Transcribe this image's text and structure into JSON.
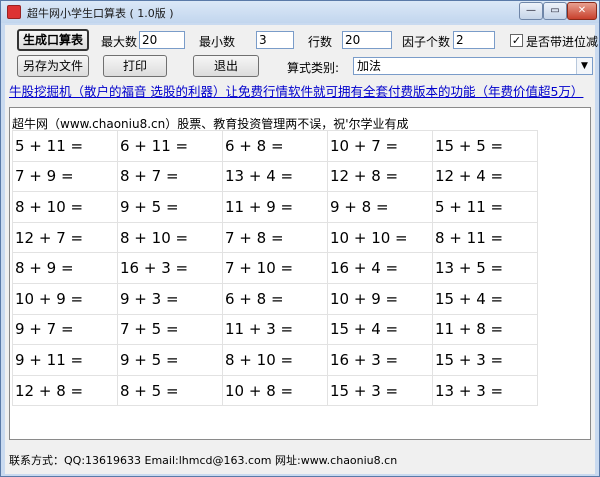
{
  "window": {
    "title": "超牛网小学生口算表 ( 1.0版 )",
    "controls": {
      "min": "—",
      "max": "▭",
      "close": "✕"
    }
  },
  "toolbar": {
    "generate_label": "生成口算表",
    "max_label": "最大数",
    "max_value": "20",
    "min_label": "最小数",
    "min_value": "3",
    "rows_label": "行数",
    "rows_value": "20",
    "factors_label": "因子个数",
    "factors_value": "2",
    "carry_label": "是否带进位减",
    "carry_checked": true,
    "save_as_label": "另存为文件",
    "print_label": "打印",
    "exit_label": "退出",
    "formula_type_label": "算式类别:",
    "formula_type_value": "加法"
  },
  "promo_link": "牛股挖掘机（散户的福音 选股的利器）让免费行情软件就可拥有全套付费版本的功能（年费价值超5万）",
  "sheet": {
    "header": "超牛网（www.chaoniu8.cn）股票、教育投资管理两不误，祝'尔学业有成",
    "rows": [
      [
        "5 + 11 =",
        "6 + 11 =",
        "6 + 8 =",
        "10 + 7 =",
        "15 + 5 ="
      ],
      [
        "7 + 9 =",
        "8 + 7 =",
        "13 + 4 =",
        "12 + 8 =",
        "12 + 4 ="
      ],
      [
        "8 + 10 =",
        "9 + 5 =",
        "11 + 9 =",
        "9 + 8 =",
        "5 + 11 ="
      ],
      [
        "12 + 7 =",
        "8 + 10 =",
        "7 + 8 =",
        "10 + 10 =",
        "8 + 11 ="
      ],
      [
        "8 + 9 =",
        "16 + 3 =",
        "7 + 10 =",
        "16 + 4 =",
        "13 + 5 ="
      ],
      [
        "10 + 9 =",
        "9 + 3 =",
        "6 + 8 =",
        "10 + 9 =",
        "15 + 4 ="
      ],
      [
        "9 + 7 =",
        "7 + 5 =",
        "11 + 3 =",
        "15 + 4 =",
        "11 + 8 ="
      ],
      [
        "9 + 11 =",
        "9 + 5 =",
        "8 + 10 =",
        "16 + 3 =",
        "15 + 3 ="
      ],
      [
        "12 + 8 =",
        "8 + 5 =",
        "10 + 8 =",
        "15 + 3 =",
        "13 + 3 ="
      ]
    ]
  },
  "footer": "联系方式：QQ:13619633  Email:lhmcd@163.com 网址:www.chaoniu8.cn"
}
